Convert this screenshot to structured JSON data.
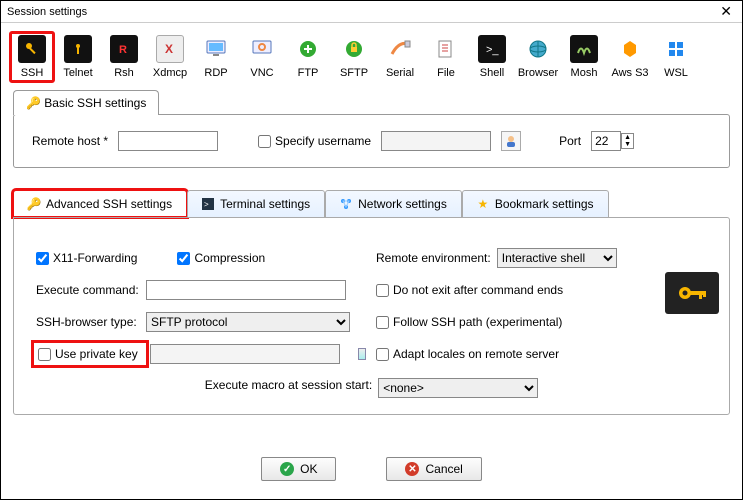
{
  "window": {
    "title": "Session settings"
  },
  "toolbar": {
    "items": [
      {
        "label": "SSH"
      },
      {
        "label": "Telnet"
      },
      {
        "label": "Rsh"
      },
      {
        "label": "Xdmcp"
      },
      {
        "label": "RDP"
      },
      {
        "label": "VNC"
      },
      {
        "label": "FTP"
      },
      {
        "label": "SFTP"
      },
      {
        "label": "Serial"
      },
      {
        "label": "File"
      },
      {
        "label": "Shell"
      },
      {
        "label": "Browser"
      },
      {
        "label": "Mosh"
      },
      {
        "label": "Aws S3"
      },
      {
        "label": "WSL"
      }
    ],
    "selected_index": 0
  },
  "basic": {
    "tab_label": "Basic SSH settings",
    "remote_host_label": "Remote host *",
    "remote_host_value": "",
    "specify_username_label": "Specify username",
    "specify_username_checked": false,
    "username_value": "",
    "port_label": "Port",
    "port_value": "22"
  },
  "sub_tabs": {
    "advanced": "Advanced SSH settings",
    "terminal": "Terminal settings",
    "network": "Network settings",
    "bookmark": "Bookmark settings",
    "active": "advanced"
  },
  "advanced": {
    "x11_label": "X11-Forwarding",
    "x11_checked": true,
    "compression_label": "Compression",
    "compression_checked": true,
    "remote_env_label": "Remote environment:",
    "remote_env_value": "Interactive shell",
    "exec_cmd_label": "Execute command:",
    "exec_cmd_value": "",
    "no_exit_label": "Do not exit after command ends",
    "no_exit_checked": false,
    "browser_type_label": "SSH-browser type:",
    "browser_type_value": "SFTP protocol",
    "follow_path_label": "Follow SSH path (experimental)",
    "follow_path_checked": false,
    "use_pk_label": "Use private key",
    "use_pk_checked": false,
    "pk_path_value": "",
    "adapt_locales_label": "Adapt locales on remote server",
    "adapt_locales_checked": false,
    "exec_macro_label": "Execute macro at session start:",
    "exec_macro_value": "<none>"
  },
  "footer": {
    "ok": "OK",
    "cancel": "Cancel"
  },
  "colors": {
    "highlight_red": "#e11",
    "accent_blue": "#2a6fd8",
    "ok_green": "#2aa54a",
    "cancel_red": "#d23c2a",
    "key_yellow": "#f7b500"
  }
}
